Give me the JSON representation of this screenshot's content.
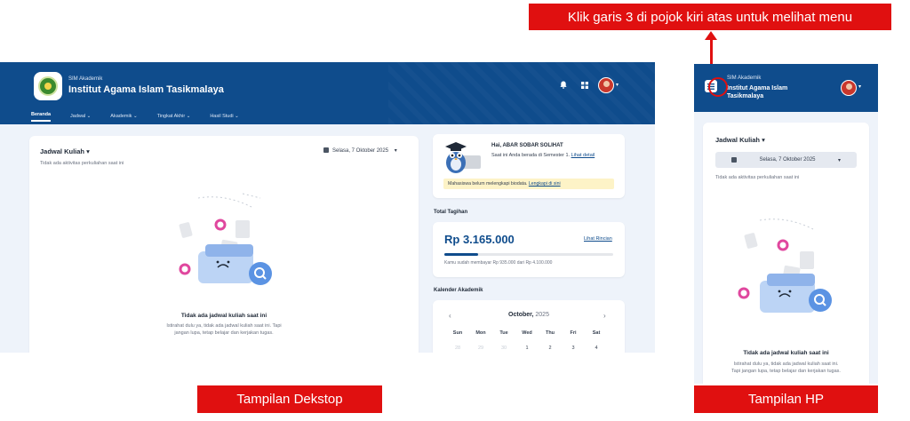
{
  "top_callout": "Klik garis 3 di pojok kiri atas untuk melihat menu",
  "desktop_label": "Tampilan Dekstop",
  "mobile_label": "Tampilan HP",
  "app": {
    "small": "SIM Akademik",
    "title": "Institut Agama Islam Tasikmalaya"
  },
  "nav": [
    "Beranda",
    "Jadwal ⌄",
    "Akademik ⌄",
    "Tingkat Akhir ⌄",
    "Hasil Studi ⌄"
  ],
  "schedule": {
    "title": "Jadwal Kuliah",
    "caret": "▾",
    "date": "Selasa, 7 Oktober 2025",
    "no_activity": "Tidak ada aktivitas perkuliahan saat ini",
    "empty_title": "Tidak ada jadwal kuliah saat ini",
    "empty_desc_1": "Istirahat dulu ya, tidak ada jadwal kuliah saat ini. Tapi",
    "empty_desc_2": "jangan lupa, tetap belajar dan kerjakan tugas."
  },
  "greeting": {
    "title": "Hai, ABAR SOBAR SOLIHAT",
    "line1": "Saat ini Anda berada di Semester 1.",
    "detail_link": "Lihat detail",
    "warning": "Mahasiswa belum melengkapi biodata.",
    "warning_link": "Lengkapi di sini"
  },
  "billing": {
    "section": "Total Tagihan",
    "amount": "Rp 3.165.000",
    "detail_link": "Lihat Rincian",
    "paid_fraction": 0.2,
    "note": "Kamu sudah membayar Rp 935.000 dari Rp 4.100.000"
  },
  "calendar": {
    "section": "Kalender Akademik",
    "month": "October,",
    "year": "2025",
    "prev": "‹",
    "next": "›",
    "weekdays": [
      "Sun",
      "Mon",
      "Tue",
      "Wed",
      "Thu",
      "Fri",
      "Sat"
    ],
    "days": [
      "28",
      "29",
      "30",
      "1",
      "2",
      "3",
      "4"
    ]
  },
  "mobile": {
    "empty_desc_1": "Istirahat dulu ya, tidak ada jadwal kuliah saat ini.",
    "empty_desc_2": "Tapi jangan lupa, tetap belajar dan kerjakan tugas."
  },
  "colors": {
    "brand": "#0f4c8c",
    "callout": "#e01010",
    "warning_bg": "#fdf3c7",
    "accent_pink": "#e0479e"
  },
  "icons": [
    "bell-icon",
    "grid-icon",
    "calendar-icon",
    "menu-icon",
    "search-icon",
    "gear-icon"
  ]
}
